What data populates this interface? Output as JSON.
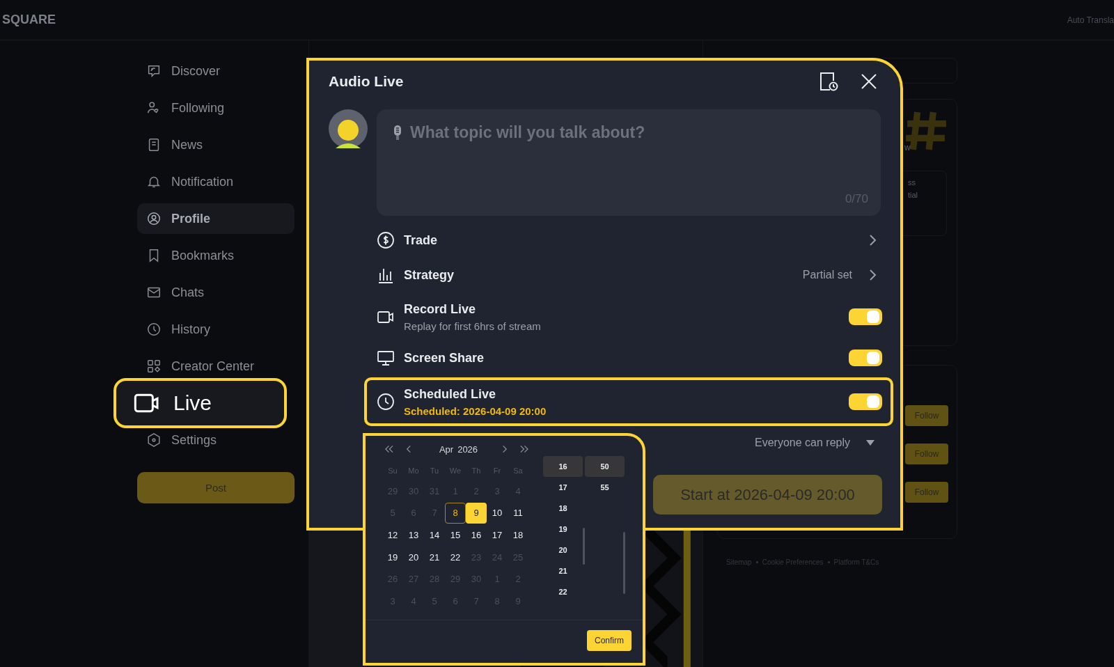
{
  "header": {
    "logo": "SQUARE",
    "translate": "Auto Transla"
  },
  "sidebar": {
    "items": [
      {
        "label": "Discover",
        "selected": false,
        "highlighted": false
      },
      {
        "label": "Following",
        "selected": false,
        "highlighted": false
      },
      {
        "label": "News",
        "selected": false,
        "highlighted": false
      },
      {
        "label": "Notification",
        "selected": false,
        "highlighted": false
      },
      {
        "label": "Profile",
        "selected": true,
        "highlighted": false
      },
      {
        "label": "Bookmarks",
        "selected": false,
        "highlighted": false
      },
      {
        "label": "Chats",
        "selected": false,
        "highlighted": false
      },
      {
        "label": "History",
        "selected": false,
        "highlighted": false
      },
      {
        "label": "Creator Center",
        "selected": false,
        "highlighted": false
      },
      {
        "label": "Live",
        "selected": false,
        "highlighted": true
      },
      {
        "label": "Settings",
        "selected": false,
        "highlighted": false
      }
    ],
    "post_button": "Post"
  },
  "background": {
    "fragments": [
      "w",
      "ss",
      "tial"
    ],
    "follow_buttons": [
      "Follow",
      "Follow",
      "Follow"
    ],
    "footer_links": [
      "Sitemap",
      "Cookie Preferences",
      "Platform T&Cs"
    ]
  },
  "modal": {
    "title": "Audio Live",
    "topic": {
      "placeholder": "What topic will you talk about?",
      "counter": "0/70"
    },
    "options": [
      {
        "kind": "link",
        "label": "Trade",
        "highlighted": false
      },
      {
        "kind": "link",
        "label": "Strategy",
        "value": "Partial set",
        "highlighted": false
      },
      {
        "kind": "toggle",
        "label": "Record Live",
        "sublabel": "Replay for first 6hrs of stream",
        "sublabel_accent": false,
        "on": true,
        "highlighted": false
      },
      {
        "kind": "toggle",
        "label": "Screen Share",
        "on": true,
        "highlighted": false
      },
      {
        "kind": "toggle",
        "label": "Scheduled Live",
        "sublabel": "Scheduled: 2026-04-09 20:00",
        "sublabel_accent": true,
        "on": true,
        "highlighted": true
      }
    ],
    "reply_setting": "Everyone can reply",
    "start_button": "Start at 2026-04-09 20:00"
  },
  "calendar": {
    "month": "Apr",
    "year": "2026",
    "weekdays": [
      "Su",
      "Mo",
      "Tu",
      "We",
      "Th",
      "Fr",
      "Sa"
    ],
    "weeks": [
      [
        {
          "d": "29",
          "disabled": true,
          "today": false,
          "selected": false
        },
        {
          "d": "30",
          "disabled": true,
          "today": false,
          "selected": false
        },
        {
          "d": "31",
          "disabled": true,
          "today": false,
          "selected": false
        },
        {
          "d": "1",
          "disabled": true,
          "today": false,
          "selected": false
        },
        {
          "d": "2",
          "disabled": true,
          "today": false,
          "selected": false
        },
        {
          "d": "3",
          "disabled": true,
          "today": false,
          "selected": false
        },
        {
          "d": "4",
          "disabled": true,
          "today": false,
          "selected": false
        }
      ],
      [
        {
          "d": "5",
          "disabled": true,
          "today": false,
          "selected": false
        },
        {
          "d": "6",
          "disabled": true,
          "today": false,
          "selected": false
        },
        {
          "d": "7",
          "disabled": true,
          "today": false,
          "selected": false
        },
        {
          "d": "8",
          "disabled": false,
          "today": true,
          "selected": false
        },
        {
          "d": "9",
          "disabled": false,
          "today": false,
          "selected": true
        },
        {
          "d": "10",
          "disabled": false,
          "today": false,
          "selected": false
        },
        {
          "d": "11",
          "disabled": false,
          "today": false,
          "selected": false
        }
      ],
      [
        {
          "d": "12",
          "disabled": false,
          "today": false,
          "selected": false
        },
        {
          "d": "13",
          "disabled": false,
          "today": false,
          "selected": false
        },
        {
          "d": "14",
          "disabled": false,
          "today": false,
          "selected": false
        },
        {
          "d": "15",
          "disabled": false,
          "today": false,
          "selected": false
        },
        {
          "d": "16",
          "disabled": false,
          "today": false,
          "selected": false
        },
        {
          "d": "17",
          "disabled": false,
          "today": false,
          "selected": false
        },
        {
          "d": "18",
          "disabled": false,
          "today": false,
          "selected": false
        }
      ],
      [
        {
          "d": "19",
          "disabled": false,
          "today": false,
          "selected": false
        },
        {
          "d": "20",
          "disabled": false,
          "today": false,
          "selected": false
        },
        {
          "d": "21",
          "disabled": false,
          "today": false,
          "selected": false
        },
        {
          "d": "22",
          "disabled": false,
          "today": false,
          "selected": false
        },
        {
          "d": "23",
          "disabled": true,
          "today": false,
          "selected": false
        },
        {
          "d": "24",
          "disabled": true,
          "today": false,
          "selected": false
        },
        {
          "d": "25",
          "disabled": true,
          "today": false,
          "selected": false
        }
      ],
      [
        {
          "d": "26",
          "disabled": true,
          "today": false,
          "selected": false
        },
        {
          "d": "27",
          "disabled": true,
          "today": false,
          "selected": false
        },
        {
          "d": "28",
          "disabled": true,
          "today": false,
          "selected": false
        },
        {
          "d": "29",
          "disabled": true,
          "today": false,
          "selected": false
        },
        {
          "d": "30",
          "disabled": true,
          "today": false,
          "selected": false
        },
        {
          "d": "1",
          "disabled": true,
          "today": false,
          "selected": false
        },
        {
          "d": "2",
          "disabled": true,
          "today": false,
          "selected": false
        }
      ],
      [
        {
          "d": "3",
          "disabled": true,
          "today": false,
          "selected": false
        },
        {
          "d": "4",
          "disabled": true,
          "today": false,
          "selected": false
        },
        {
          "d": "5",
          "disabled": true,
          "today": false,
          "selected": false
        },
        {
          "d": "6",
          "disabled": true,
          "today": false,
          "selected": false
        },
        {
          "d": "7",
          "disabled": true,
          "today": false,
          "selected": false
        },
        {
          "d": "8",
          "disabled": true,
          "today": false,
          "selected": false
        },
        {
          "d": "9",
          "disabled": true,
          "today": false,
          "selected": false
        }
      ]
    ],
    "hours": [
      {
        "label": "16",
        "selected": true
      },
      {
        "label": "17",
        "selected": false
      },
      {
        "label": "18",
        "selected": false
      },
      {
        "label": "19",
        "selected": false
      },
      {
        "label": "20",
        "selected": false
      },
      {
        "label": "21",
        "selected": false
      },
      {
        "label": "22",
        "selected": false
      }
    ],
    "minutes": [
      {
        "label": "50",
        "selected": true
      },
      {
        "label": "55",
        "selected": false
      }
    ],
    "confirm": "Confirm"
  }
}
